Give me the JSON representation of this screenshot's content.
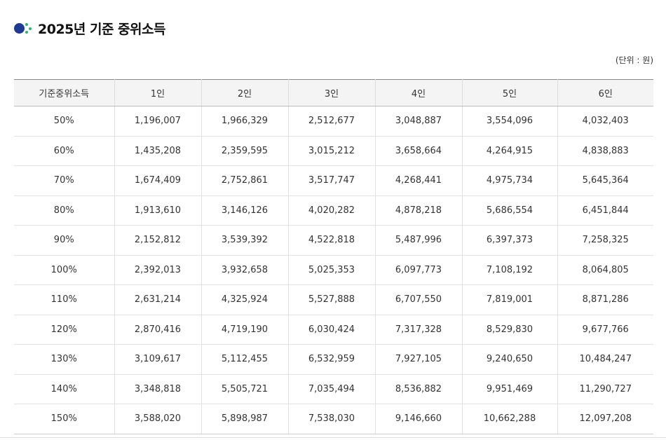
{
  "section": {
    "title": "2025년 기준 중위소득",
    "unit_note": "(단위 : 원)",
    "icon": "bullet-dots-icon"
  },
  "colors": {
    "icon_primary": "#1f3a93",
    "icon_accent": "#2bb673",
    "header_bg": "#f4f4f4"
  },
  "table": {
    "headers": [
      "기준중위소득",
      "1인",
      "2인",
      "3인",
      "4인",
      "5인",
      "6인"
    ],
    "rows": [
      [
        "50%",
        "1,196,007",
        "1,966,329",
        "2,512,677",
        "3,048,887",
        "3,554,096",
        "4,032,403"
      ],
      [
        "60%",
        "1,435,208",
        "2,359,595",
        "3,015,212",
        "3,658,664",
        "4,264,915",
        "4,838,883"
      ],
      [
        "70%",
        "1,674,409",
        "2,752,861",
        "3,517,747",
        "4,268,441",
        "4,975,734",
        "5,645,364"
      ],
      [
        "80%",
        "1,913,610",
        "3,146,126",
        "4,020,282",
        "4,878,218",
        "5,686,554",
        "6,451,844"
      ],
      [
        "90%",
        "2,152,812",
        "3,539,392",
        "4,522,818",
        "5,487,996",
        "6,397,373",
        "7,258,325"
      ],
      [
        "100%",
        "2,392,013",
        "3,932,658",
        "5,025,353",
        "6,097,773",
        "7,108,192",
        "8,064,805"
      ],
      [
        "110%",
        "2,631,214",
        "4,325,924",
        "5,527,888",
        "6,707,550",
        "7,819,001",
        "8,871,286"
      ],
      [
        "120%",
        "2,870,416",
        "4,719,190",
        "6,030,424",
        "7,317,328",
        "8,529,830",
        "9,677,766"
      ],
      [
        "130%",
        "3,109,617",
        "5,112,455",
        "6,532,959",
        "7,927,105",
        "9,240,650",
        "10,484,247"
      ],
      [
        "140%",
        "3,348,818",
        "5,505,721",
        "7,035,494",
        "8,536,882",
        "9,951,469",
        "11,290,727"
      ],
      [
        "150%",
        "3,588,020",
        "5,898,987",
        "7,538,030",
        "9,146,660",
        "10,662,288",
        "12,097,208"
      ]
    ]
  }
}
